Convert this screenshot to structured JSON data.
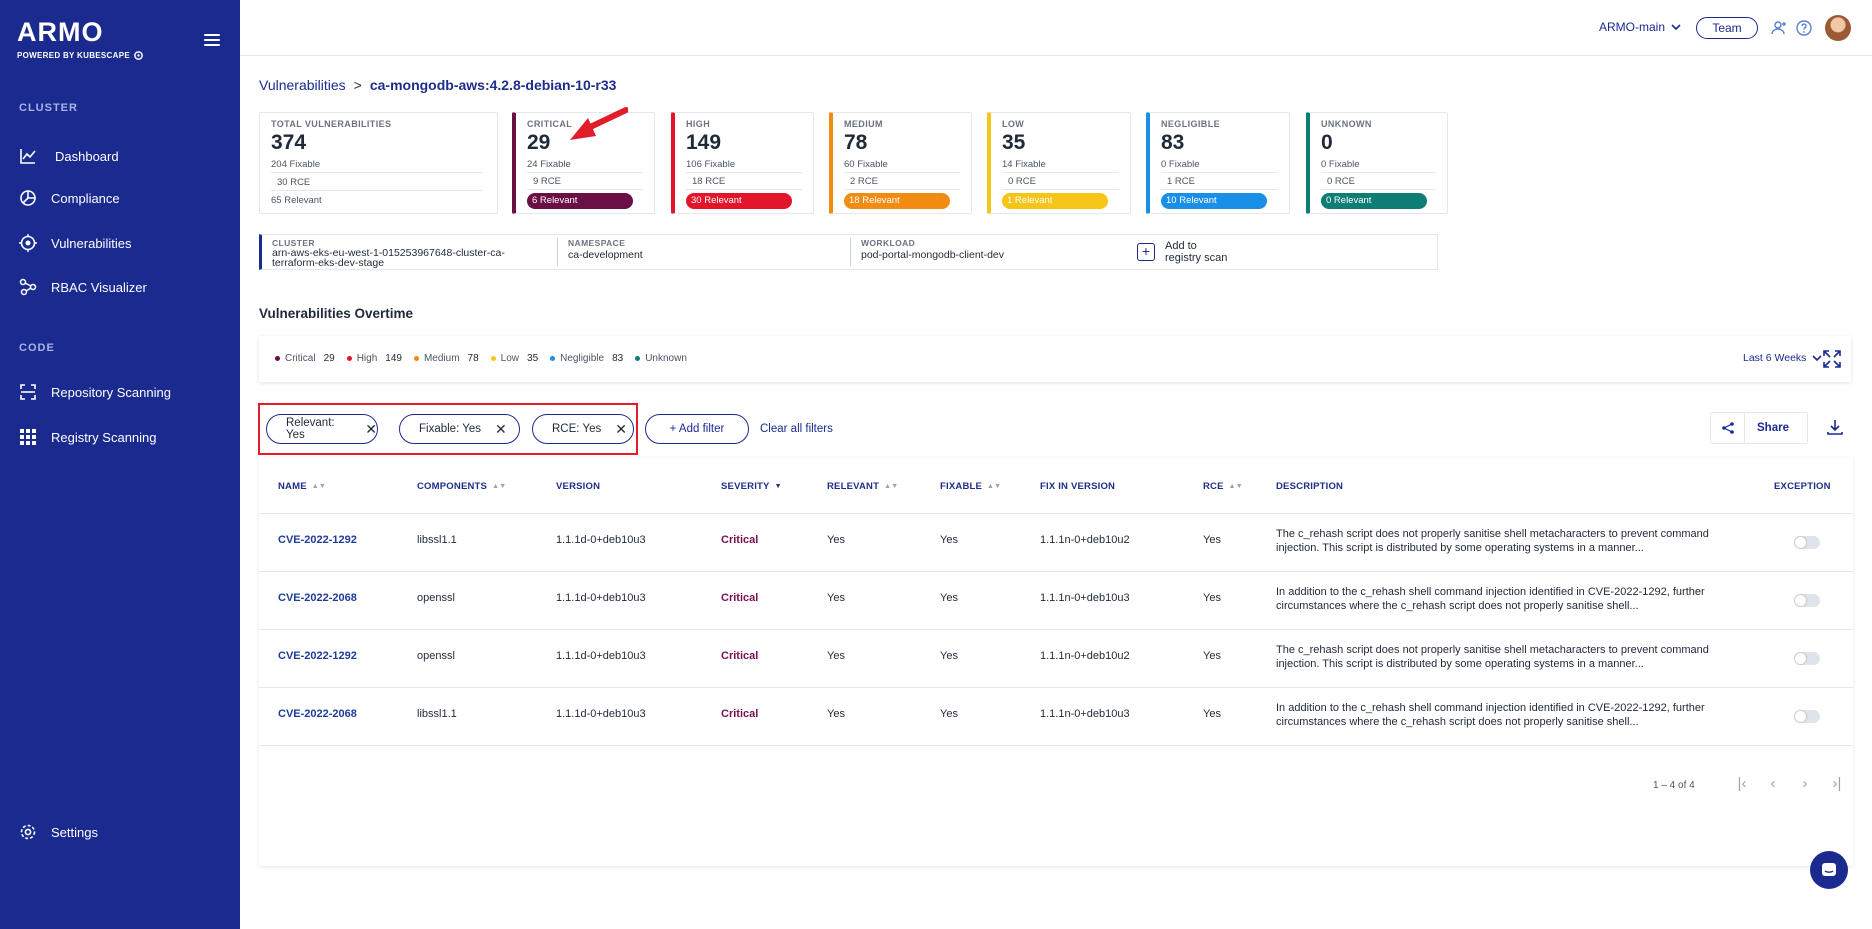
{
  "sidebar": {
    "logo": "ARMO",
    "logo_sub": "POWERED BY KUBESCAPE",
    "section_cluster": "CLUSTER",
    "section_code": "CODE",
    "items": [
      {
        "label": "Dashboard",
        "icon": "chart-line-icon"
      },
      {
        "label": "Compliance",
        "icon": "pie-chart-icon"
      },
      {
        "label": "Vulnerabilities",
        "icon": "bug-target-icon"
      },
      {
        "label": "RBAC Visualizer",
        "icon": "graph-nodes-icon"
      },
      {
        "label": "Repository Scanning",
        "icon": "scan-frame-icon"
      },
      {
        "label": "Registry Scanning",
        "icon": "grid-icon"
      },
      {
        "label": "Settings",
        "icon": "gear-icon"
      }
    ]
  },
  "topbar": {
    "cluster": "ARMO-main",
    "team_label": "Team"
  },
  "breadcrumb": {
    "root": "Vulnerabilities",
    "sep": ">",
    "current": "ca-mongodb-aws:4.2.8-debian-10-r33"
  },
  "total": {
    "label": "TOTAL VULNERABILITIES",
    "count": "374",
    "fixable": "204 Fixable",
    "rce": "30 RCE",
    "relevant": "65 Relevant"
  },
  "severities": [
    {
      "label": "CRITICAL",
      "count": "29",
      "fixable": "24 Fixable",
      "rce": "9 RCE",
      "relevant": "6 Relevant",
      "color": "#6b0f47"
    },
    {
      "label": "HIGH",
      "count": "149",
      "fixable": "106 Fixable",
      "rce": "18 RCE",
      "relevant": "30 Relevant",
      "color": "#e3152a"
    },
    {
      "label": "MEDIUM",
      "count": "78",
      "fixable": "60 Fixable",
      "rce": "2 RCE",
      "relevant": "18 Relevant",
      "color": "#f28b12"
    },
    {
      "label": "LOW",
      "count": "35",
      "fixable": "14 Fixable",
      "rce": "0 RCE",
      "relevant": "1 Relevant",
      "color": "#f5c518"
    },
    {
      "label": "NEGLIGIBLE",
      "count": "83",
      "fixable": "0 Fixable",
      "rce": "1 RCE",
      "relevant": "10 Relevant",
      "color": "#1a8fe8"
    },
    {
      "label": "UNKNOWN",
      "count": "0",
      "fixable": "0 Fixable",
      "rce": "0 RCE",
      "relevant": "0 Relevant",
      "color": "#0e7d76"
    }
  ],
  "info": {
    "cluster_label": "CLUSTER",
    "cluster_value": "arn-aws-eks-eu-west-1-015253967648-cluster-ca-terraform-eks-dev-stage",
    "namespace_label": "NAMESPACE",
    "namespace_value": "ca-development",
    "workload_label": "WORKLOAD",
    "workload_value": "pod-portal-mongodb-client-dev",
    "add_registry_line1": "Add to",
    "add_registry_line2": "registry scan"
  },
  "overtime": {
    "title": "Vulnerabilities Overtime",
    "period": "Last 6 Weeks",
    "legend": [
      {
        "name": "Critical",
        "count": "29",
        "color": "#6b0f47"
      },
      {
        "name": "High",
        "count": "149",
        "color": "#e3152a"
      },
      {
        "name": "Medium",
        "count": "78",
        "color": "#f28b12"
      },
      {
        "name": "Low",
        "count": "35",
        "color": "#f5c518"
      },
      {
        "name": "Negligible",
        "count": "83",
        "color": "#1a8fe8"
      },
      {
        "name": "Unknown",
        "count": "",
        "color": "#0e7d76"
      }
    ]
  },
  "filters": {
    "chips": [
      "Relevant: Yes",
      "Fixable: Yes",
      "RCE: Yes"
    ],
    "add_label": "+ Add filter",
    "clear_label": "Clear all filters",
    "share_label": "Share"
  },
  "table": {
    "headers": [
      "NAME",
      "COMPONENTS",
      "VERSION",
      "SEVERITY",
      "RELEVANT",
      "FIXABLE",
      "FIX IN VERSION",
      "RCE",
      "DESCRIPTION",
      "EXCEPTION"
    ],
    "rows": [
      {
        "name": "CVE-2022-1292",
        "component": "libssl1.1",
        "version": "1.1.1d-0+deb10u3",
        "severity": "Critical",
        "relevant": "Yes",
        "fixable": "Yes",
        "fix_version": "1.1.1n-0+deb10u2",
        "rce": "Yes",
        "description": "The c_rehash script does not properly sanitise shell metacharacters to prevent command injection. This script is distributed by some operating systems in a manner..."
      },
      {
        "name": "CVE-2022-2068",
        "component": "openssl",
        "version": "1.1.1d-0+deb10u3",
        "severity": "Critical",
        "relevant": "Yes",
        "fixable": "Yes",
        "fix_version": "1.1.1n-0+deb10u3",
        "rce": "Yes",
        "description": "In addition to the c_rehash shell command injection identified in CVE-2022-1292, further circumstances where the c_rehash script does not properly sanitise shell..."
      },
      {
        "name": "CVE-2022-1292",
        "component": "openssl",
        "version": "1.1.1d-0+deb10u3",
        "severity": "Critical",
        "relevant": "Yes",
        "fixable": "Yes",
        "fix_version": "1.1.1n-0+deb10u2",
        "rce": "Yes",
        "description": "The c_rehash script does not properly sanitise shell metacharacters to prevent command injection. This script is distributed by some operating systems in a manner..."
      },
      {
        "name": "CVE-2022-2068",
        "component": "libssl1.1",
        "version": "1.1.1d-0+deb10u3",
        "severity": "Critical",
        "relevant": "Yes",
        "fixable": "Yes",
        "fix_version": "1.1.1n-0+deb10u3",
        "rce": "Yes",
        "description": "In addition to the c_rehash shell command injection identified in CVE-2022-1292, further circumstances where the c_rehash script does not properly sanitise shell..."
      }
    ],
    "pagination": "1 – 4 of 4"
  }
}
